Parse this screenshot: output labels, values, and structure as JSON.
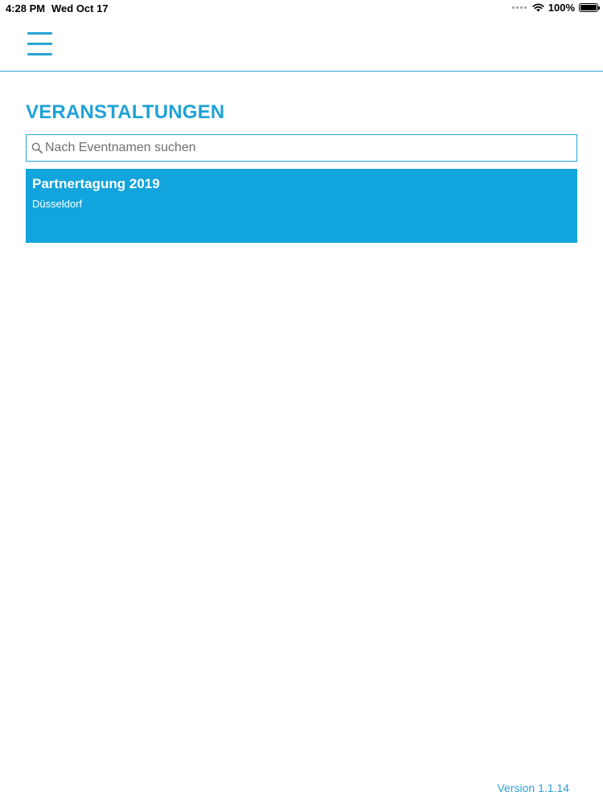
{
  "status_bar": {
    "time": "4:28 PM",
    "date": "Wed Oct 17",
    "battery_text": "100%",
    "battery_level": 1.0
  },
  "nav": {
    "menu_icon": "hamburger-menu-icon"
  },
  "page": {
    "title": "VERANSTALTUNGEN"
  },
  "search": {
    "placeholder": "Nach Eventnamen suchen",
    "value": "",
    "icon": "search-icon"
  },
  "events": [
    {
      "name": "Partnertagung 2019",
      "location": "Düsseldorf"
    }
  ],
  "footer": {
    "version": "Version 1.1.14"
  },
  "colors": {
    "accent": "#1fa2d8",
    "card": "#12a4dc",
    "text_on_card": "#ffffff"
  }
}
